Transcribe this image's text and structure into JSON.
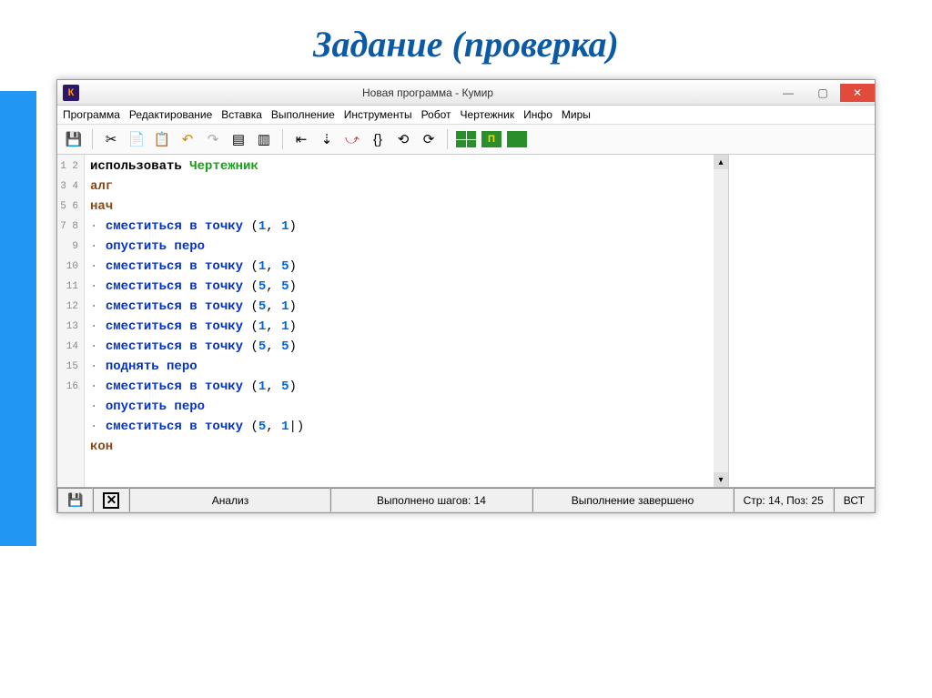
{
  "slide": {
    "title": "Задание (проверка)"
  },
  "window": {
    "title": "Новая программа - Кумир",
    "app_icon_letter": "К"
  },
  "menu": {
    "items": [
      "Программа",
      "Редактирование",
      "Вставка",
      "Выполнение",
      "Инструменты",
      "Робот",
      "Чертежник",
      "Инфо",
      "Миры"
    ]
  },
  "code": {
    "use": "использовать",
    "module": "Чертежник",
    "alg": "алг",
    "begin": "нач",
    "end": "кон",
    "cmd_move": "сместиться в точку",
    "cmd_pendown": "опустить перо",
    "cmd_penup": "поднять перо",
    "lines": [
      {
        "n": 1,
        "t": "use"
      },
      {
        "n": 2,
        "t": "alg"
      },
      {
        "n": 3,
        "t": "begin"
      },
      {
        "n": 4,
        "t": "move",
        "a": 1,
        "b": 1
      },
      {
        "n": 5,
        "t": "pendown"
      },
      {
        "n": 6,
        "t": "move",
        "a": 1,
        "b": 5
      },
      {
        "n": 7,
        "t": "move",
        "a": 5,
        "b": 5
      },
      {
        "n": 8,
        "t": "move",
        "a": 5,
        "b": 1
      },
      {
        "n": 9,
        "t": "move",
        "a": 1,
        "b": 1
      },
      {
        "n": 10,
        "t": "move",
        "a": 5,
        "b": 5
      },
      {
        "n": 11,
        "t": "penup"
      },
      {
        "n": 12,
        "t": "move",
        "a": 1,
        "b": 5
      },
      {
        "n": 13,
        "t": "pendown"
      },
      {
        "n": 14,
        "t": "move",
        "a": 5,
        "b": 1,
        "cursor": true
      },
      {
        "n": 15,
        "t": "end"
      },
      {
        "n": 16,
        "t": "empty"
      }
    ]
  },
  "status": {
    "analysis": "Анализ",
    "steps": "Выполнено шагов: 14",
    "done": "Выполнение завершено",
    "pos": "Стр: 14, Поз: 25",
    "mode": "ВСТ"
  }
}
